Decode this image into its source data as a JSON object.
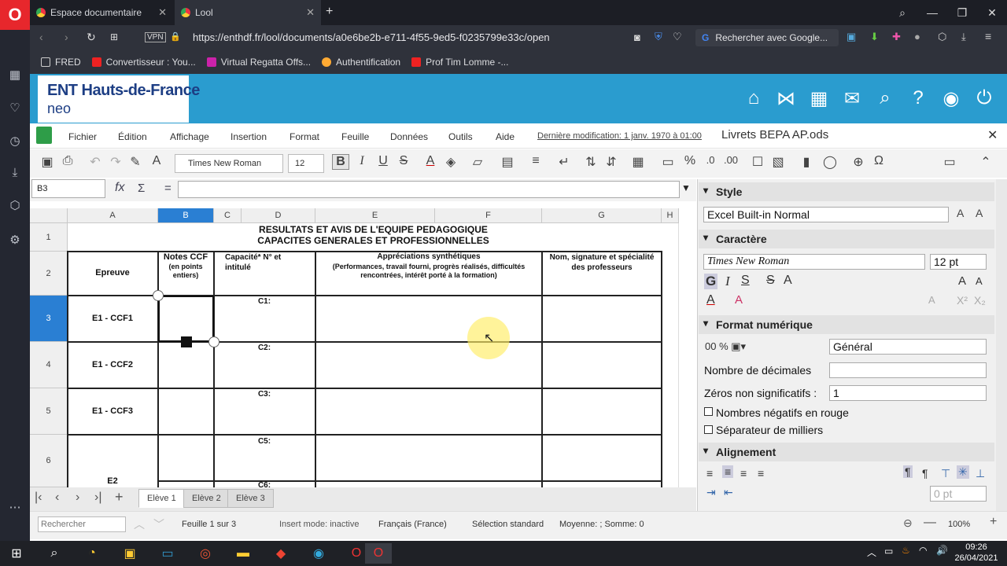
{
  "browser": {
    "tabs": [
      {
        "label": "Espace documentaire"
      },
      {
        "label": "Lool"
      }
    ],
    "url": "https://enthdf.fr/lool/documents/a0e6be2b-e711-4f55-9ed5-f0235799e33c/open",
    "search_label": "Rechercher avec Google...",
    "bookmarks": [
      "FRED",
      "Convertisseur : You...",
      "Virtual Regatta Offs...",
      "Authentification",
      "Prof Tim Lomme -..."
    ],
    "vpn": "VPN"
  },
  "ent": {
    "title": "ENT Hauts-de-France",
    "subtitle": "neo"
  },
  "menu": {
    "items": [
      "Fichier",
      "Édition",
      "Affichage",
      "Insertion",
      "Format",
      "Feuille",
      "Données",
      "Outils",
      "Aide"
    ],
    "last_modified": "Dernière modification: 1 janv. 1970 à 01:00",
    "doc_title": "Livrets BEPA AP.ods"
  },
  "toolbar": {
    "font_name": "Times New Roman",
    "font_size": "12"
  },
  "formula": {
    "cell_ref": "B3",
    "fx": "fx",
    "sigma": "Σ",
    "eq": "="
  },
  "sheet": {
    "columns": [
      "A",
      "B",
      "C",
      "D",
      "E",
      "F",
      "G",
      "H"
    ],
    "rows": [
      "1",
      "2",
      "3",
      "4",
      "5",
      "6"
    ],
    "title1": "RESULTATS ET AVIS DE L'EQUIPE PEDAGOGIQUE",
    "title2": "CAPACITES GENERALES ET PROFESSIONNELLES",
    "h_epreuve": "Epreuve",
    "h_notes": "Notes CCF",
    "h_notes_sub": "(en points entiers)",
    "h_capacite": "Capacité* N° et intitulé",
    "h_appr": "Appréciations synthétiques",
    "h_appr_sub": "(Performances, travail fourni, progrès réalisés, difficultés rencontrées, intérêt porté à la formation)",
    "h_nom": "Nom, signature et spécialité des professeurs",
    "r3": "E1 - CCF1",
    "r4": "E1 - CCF2",
    "r5": "E1 - CCF3",
    "r6": "E2",
    "c1": "C1:",
    "c2": "C2:",
    "c3": "C3:",
    "c5": "C5:",
    "c6": "C6:"
  },
  "sheet_tabs": [
    "Elève 1",
    "Elève 2",
    "Elève 3"
  ],
  "status": {
    "search_placeholder": "Rechercher",
    "sheet": "Feuille 1 sur 3",
    "insert": "Insert mode: inactive",
    "lang": "Français (France)",
    "selection": "Sélection standard",
    "sum": "Moyenne: ; Somme: 0",
    "zoom": "100%"
  },
  "sidebar": {
    "style_title": "Style",
    "style_value": "Excel Built-in Normal",
    "char_title": "Caractère",
    "font": "Times New Roman",
    "size": "12 pt",
    "num_title": "Format numérique",
    "num_value": "Général",
    "decimals_label": "Nombre de décimales",
    "zeros_label": "Zéros non significatifs :",
    "zeros_value": "1",
    "neg_label": "Nombres négatifs en rouge",
    "sep_label": "Séparateur de milliers",
    "align_title": "Alignement",
    "indent_value": "0 pt"
  },
  "taskbar": {
    "time": "09:26",
    "date": "26/04/2021"
  }
}
